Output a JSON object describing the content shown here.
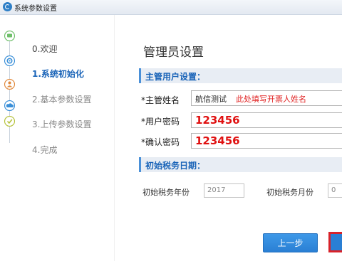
{
  "window": {
    "title": "系统参数设置"
  },
  "sidebar": {
    "steps": [
      {
        "label": "0.欢迎",
        "state": "done",
        "icon": "chat-icon"
      },
      {
        "label": "1.系统初始化",
        "state": "active",
        "icon": "gear-icon"
      },
      {
        "label": "2.基本参数设置",
        "state": "pending",
        "icon": "user-icon"
      },
      {
        "label": "3.上传参数设置",
        "state": "pending",
        "icon": "cloud-icon"
      },
      {
        "label": "4.完成",
        "state": "pending",
        "icon": "check-icon"
      }
    ]
  },
  "main": {
    "title": "管理员设置",
    "section_user": "主管用户设置：",
    "fields": {
      "name": {
        "label": "*主管姓名",
        "value": "航信测试",
        "hint": "此处填写开票人姓名"
      },
      "password": {
        "label": "*用户密码",
        "value": "123456"
      },
      "confirm": {
        "label": "*确认密码",
        "value": "123456"
      }
    },
    "section_tax": "初始税务日期：",
    "tax_year_label": "初始税务年份",
    "tax_year_value": "2017",
    "tax_month_label": "初始税务月份",
    "tax_month_value": "0"
  },
  "buttons": {
    "prev": "上一步"
  },
  "colors": {
    "accent": "#1a64b8",
    "highlight": "#e01010",
    "button": "#2a7fd4"
  }
}
